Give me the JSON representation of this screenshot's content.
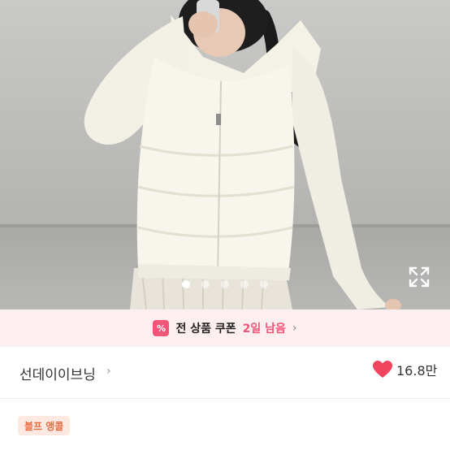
{
  "product_image": {
    "alt": "화이트 패딩 점퍼 착용 사진",
    "carousel": {
      "total": 5,
      "active": 1
    },
    "expand_icon": "expand-icon"
  },
  "coupon_banner": {
    "icon_label": "%",
    "text": "전 상품 쿠폰",
    "days_left": "2일 남음",
    "chevron": "›",
    "accent_color": "#f25577"
  },
  "shop": {
    "name": "선데이이브닝",
    "chevron": "›",
    "like_icon": "heart-icon",
    "like_count": "16.8만"
  },
  "product": {
    "badge": "블프 앵콜",
    "title_partial": ""
  }
}
